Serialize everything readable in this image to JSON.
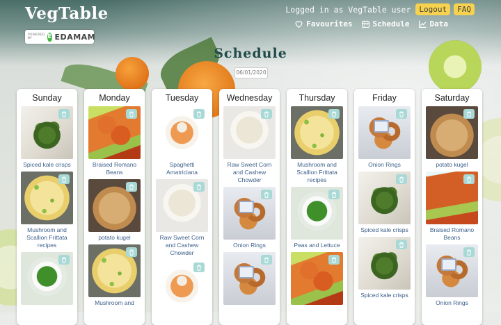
{
  "brand": {
    "logo_text": "VegTable",
    "powered_by": "POWERED BY",
    "partner": "EDAMAM",
    "partner_letter": "E"
  },
  "header": {
    "logged_in_text": "Logged in as VegTable user",
    "logout_label": "Logout",
    "faq_label": "FAQ",
    "nav": [
      {
        "label": "Favourites",
        "icon": "heart-icon"
      },
      {
        "label": "Schedule",
        "icon": "calendar-icon"
      },
      {
        "label": "Data",
        "icon": "chart-icon"
      }
    ]
  },
  "page": {
    "title": "Schedule",
    "date": "06/01/2020"
  },
  "colors": {
    "accent_pill": "#f6d24f",
    "title": "#1f4c4a",
    "meal_link": "#3c5f8a",
    "delete_button": "#a9d9d6"
  },
  "week": [
    {
      "day": "Sunday",
      "meals": [
        {
          "name": "Spiced kale crisps",
          "img": "kale"
        },
        {
          "name": "Mushroom and Scallion Frittata recipes",
          "img": "frittata"
        },
        {
          "name": "",
          "img": "peas"
        }
      ]
    },
    {
      "day": "Monday",
      "meals": [
        {
          "name": "Braised Romano Beans",
          "img": "romano"
        },
        {
          "name": "potato kugel",
          "img": "kugel"
        },
        {
          "name": "Mushroom and",
          "img": "frittata"
        }
      ]
    },
    {
      "day": "Tuesday",
      "meals": [
        {
          "name": "Spaghetti Amatriciana",
          "img": "spaghetti"
        },
        {
          "name": "Raw Sweet Corn and Cashew Chowder",
          "img": "soup"
        },
        {
          "name": "",
          "img": "spaghetti"
        }
      ]
    },
    {
      "day": "Wednesday",
      "meals": [
        {
          "name": "Raw Sweet Corn and Cashew Chowder",
          "img": "soup"
        },
        {
          "name": "Onion Rings",
          "img": "rings"
        },
        {
          "name": "",
          "img": "rings"
        }
      ]
    },
    {
      "day": "Thursday",
      "meals": [
        {
          "name": "Mushroom and Scallion Frittata recipes",
          "img": "frittata"
        },
        {
          "name": "Peas and Lettuce",
          "img": "peas"
        },
        {
          "name": "",
          "img": "romano"
        }
      ]
    },
    {
      "day": "Friday",
      "meals": [
        {
          "name": "Onion Rings",
          "img": "rings"
        },
        {
          "name": "Spiced kale crisps",
          "img": "kale"
        },
        {
          "name": "Spiced kale crisps",
          "img": "kale"
        }
      ]
    },
    {
      "day": "Saturday",
      "meals": [
        {
          "name": "potato kugel",
          "img": "kugel"
        },
        {
          "name": "Braised Romano Beans",
          "img": "romano-light"
        },
        {
          "name": "Onion Rings",
          "img": "rings"
        }
      ]
    }
  ]
}
